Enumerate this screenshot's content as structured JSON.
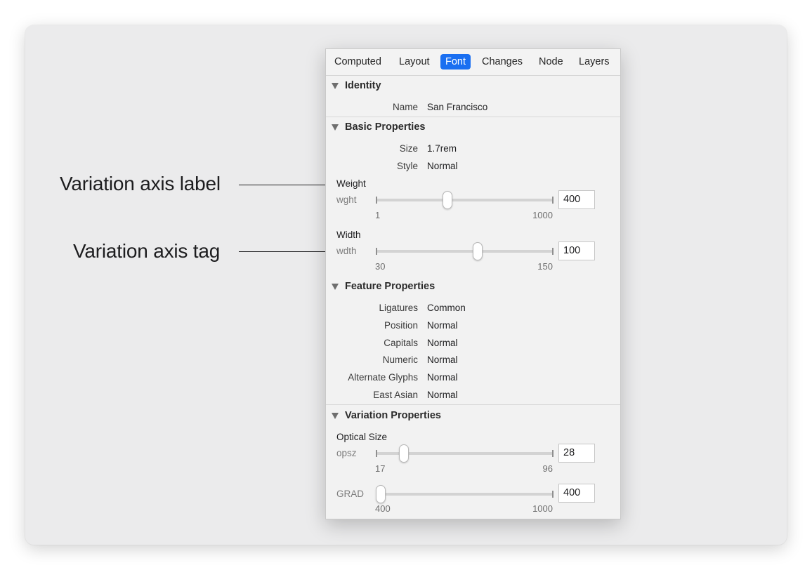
{
  "annotations": {
    "axis_label": "Variation axis label",
    "axis_tag": "Variation axis tag"
  },
  "tabs": [
    {
      "label": "Computed",
      "active": false
    },
    {
      "label": "Layout",
      "active": false
    },
    {
      "label": "Font",
      "active": true
    },
    {
      "label": "Changes",
      "active": false
    },
    {
      "label": "Node",
      "active": false
    },
    {
      "label": "Layers",
      "active": false
    }
  ],
  "identity": {
    "title": "Identity",
    "name_label": "Name",
    "name_value": "San Francisco"
  },
  "basic": {
    "title": "Basic Properties",
    "size_label": "Size",
    "size_value": "1.7rem",
    "style_label": "Style",
    "style_value": "Normal",
    "axes": [
      {
        "name": "Weight",
        "tag": "wght",
        "min": "1",
        "max": "1000",
        "value": "400",
        "level": 0.3994
      },
      {
        "name": "Width",
        "tag": "wdth",
        "min": "30",
        "max": "150",
        "value": "100",
        "level": 0.5833
      }
    ]
  },
  "feature": {
    "title": "Feature Properties",
    "rows": [
      {
        "label": "Ligatures",
        "value": "Common"
      },
      {
        "label": "Position",
        "value": "Normal"
      },
      {
        "label": "Capitals",
        "value": "Normal"
      },
      {
        "label": "Numeric",
        "value": "Normal"
      },
      {
        "label": "Alternate Glyphs",
        "value": "Normal"
      },
      {
        "label": "East Asian",
        "value": "Normal"
      }
    ]
  },
  "variation": {
    "title": "Variation Properties",
    "axes": [
      {
        "name": "Optical Size",
        "tag": "opsz",
        "min": "17",
        "max": "96",
        "value": "28",
        "level": 0.1392
      },
      {
        "name": "",
        "tag": "GRAD",
        "min": "400",
        "max": "1000",
        "value": "400",
        "level": 0
      }
    ]
  },
  "colors": {
    "accent": "#1a6ff1",
    "panel_bg": "#f2f2f2",
    "backdrop": "#ebebec"
  }
}
